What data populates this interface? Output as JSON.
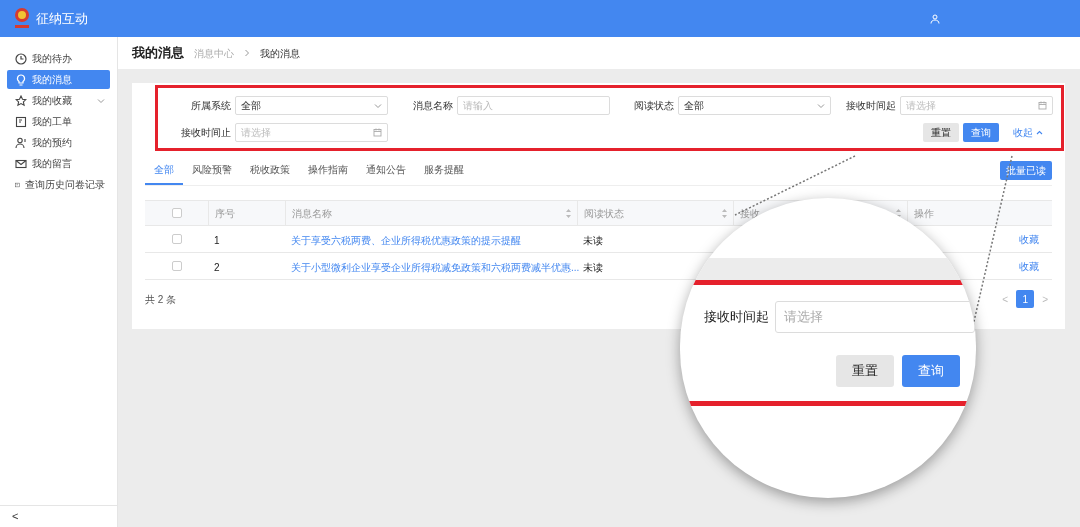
{
  "app": {
    "title": "征纳互动"
  },
  "sidebar": {
    "items": [
      {
        "label": "我的待办",
        "selected": false,
        "expandable": false
      },
      {
        "label": "我的消息",
        "selected": true,
        "expandable": false
      },
      {
        "label": "我的收藏",
        "selected": false,
        "expandable": true
      },
      {
        "label": "我的工单",
        "selected": false,
        "expandable": false
      },
      {
        "label": "我的预约",
        "selected": false,
        "expandable": false
      },
      {
        "label": "我的留言",
        "selected": false,
        "expandable": false
      },
      {
        "label": "查询历史问卷记录",
        "selected": false,
        "expandable": false
      }
    ],
    "collapse": "<"
  },
  "page": {
    "title": "我的消息",
    "breadcrumb": [
      "消息中心",
      "我的消息"
    ]
  },
  "filters": [
    {
      "label": "所属系统",
      "kind": "select",
      "value": "全部"
    },
    {
      "label": "消息名称",
      "kind": "text",
      "placeholder": "请输入"
    },
    {
      "label": "阅读状态",
      "kind": "select",
      "value": "全部"
    },
    {
      "label": "接收时间起",
      "kind": "date",
      "placeholder": "请选择"
    },
    {
      "label": "接收时间止",
      "kind": "date",
      "placeholder": "请选择"
    }
  ],
  "filter_buttons": {
    "reset": "重置",
    "search": "查询",
    "collapse": "收起"
  },
  "tabs": [
    {
      "label": "全部",
      "selected": true
    },
    {
      "label": "风险预警",
      "selected": false
    },
    {
      "label": "税收政策",
      "selected": false
    },
    {
      "label": "操作指南",
      "selected": false
    },
    {
      "label": "通知公告",
      "selected": false
    },
    {
      "label": "服务提醒",
      "selected": false
    }
  ],
  "bulk_button": "批量已读",
  "table": {
    "header_checked": false,
    "columns": [
      {
        "label": "序号",
        "sortable": false
      },
      {
        "label": "消息名称",
        "sortable": true
      },
      {
        "label": "阅读状态",
        "sortable": true
      },
      {
        "label": "接收",
        "sortable": true
      },
      {
        "label": "操作",
        "sortable": false
      }
    ],
    "rows": [
      {
        "checked": false,
        "index": "1",
        "title": "关于享受六税两费、企业所得税优惠政策的提示提醒",
        "status": "未读",
        "action": "收藏"
      },
      {
        "checked": false,
        "index": "2",
        "title": "关于小型微利企业享受企业所得税减免政策和六税两费减半优惠...",
        "status": "未读",
        "action": "收藏"
      }
    ]
  },
  "footer": {
    "total": "共 2 条",
    "pages": [
      {
        "label": "1",
        "selected": true
      }
    ],
    "prev": "<",
    "next": ">"
  },
  "magnifier": {
    "label": "接收时间起",
    "placeholder": "请选择",
    "buttons": [
      "重置",
      "查询"
    ]
  }
}
